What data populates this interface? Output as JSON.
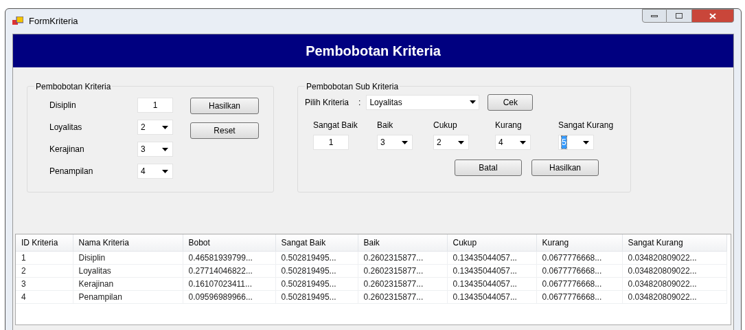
{
  "window": {
    "title": "FormKriteria"
  },
  "header": "Pembobotan Kriteria",
  "left_group": {
    "title": "Pembobotan Kriteria",
    "rows": [
      {
        "label": "Disiplin",
        "kind": "text",
        "value": "1"
      },
      {
        "label": "Loyalitas",
        "kind": "combo",
        "value": "2"
      },
      {
        "label": "Kerajinan",
        "kind": "combo",
        "value": "3"
      },
      {
        "label": "Penampilan",
        "kind": "combo",
        "value": "4"
      }
    ],
    "buttons": [
      "Hasilkan",
      "Reset"
    ]
  },
  "right_group": {
    "title": "Pembobotan Sub Kriteria",
    "pick_label": "Pilih Kriteria",
    "separator": ":",
    "pick_value": "Loyalitas",
    "check_button": "Cek",
    "fields": [
      {
        "label": "Sangat Baik",
        "kind": "text",
        "value": "1",
        "text_selected": false
      },
      {
        "label": "Baik",
        "kind": "combo",
        "value": "3",
        "text_selected": false
      },
      {
        "label": "Cukup",
        "kind": "combo",
        "value": "2",
        "text_selected": false
      },
      {
        "label": "Kurang",
        "kind": "combo",
        "value": "4",
        "text_selected": false
      },
      {
        "label": "Sangat Kurang",
        "kind": "combo",
        "value": "5",
        "text_selected": true
      }
    ],
    "buttons": [
      "Batal",
      "Hasilkan"
    ]
  },
  "table": {
    "columns": [
      "ID Kriteria",
      "Nama Kriteria",
      "Bobot",
      "Sangat Baik",
      "Baik",
      "Cukup",
      "Kurang",
      "Sangat Kurang"
    ],
    "rows": [
      [
        "1",
        "Disiplin",
        "0.46581939799...",
        "0.502819495...",
        "0.2602315877...",
        "0.13435044057...",
        "0.0677776668...",
        "0.034820809022..."
      ],
      [
        "2",
        "Loyalitas",
        "0.27714046822...",
        "0.502819495...",
        "0.2602315877...",
        "0.13435044057...",
        "0.0677776668...",
        "0.034820809022..."
      ],
      [
        "3",
        "Kerajinan",
        "0.16107023411...",
        "0.502819495...",
        "0.2602315877...",
        "0.13435044057...",
        "0.0677776668...",
        "0.034820809022..."
      ],
      [
        "4",
        "Penampilan",
        "0.09596989966...",
        "0.502819495...",
        "0.2602315877...",
        "0.13435044057...",
        "0.0677776668...",
        "0.034820809022..."
      ]
    ]
  }
}
